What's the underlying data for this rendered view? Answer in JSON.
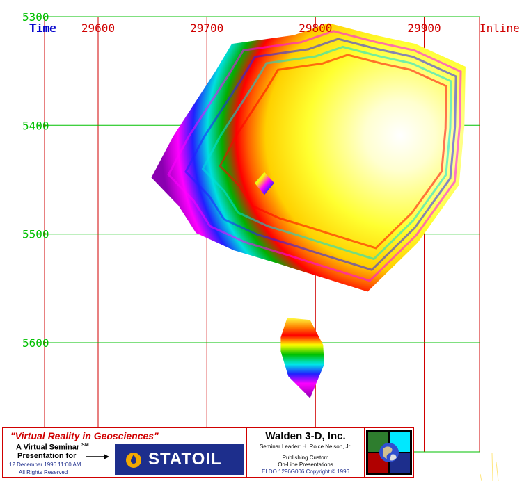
{
  "axes": {
    "corner_labels": [
      "Time",
      "Time",
      "Inline"
    ],
    "x_axis_label": "Inline",
    "top_y_label": "5300"
  },
  "chart_data": {
    "type": "heatmap",
    "title": "",
    "xlabel": "Inline",
    "ylabel": "Time",
    "x_ticks": [
      29600,
      29700,
      29800,
      29900
    ],
    "x_tick_labels": [
      "29600",
      "29700",
      "29800",
      "29900"
    ],
    "y_ticks": [
      5300,
      5400,
      5500,
      5600
    ],
    "y_tick_labels": [
      "5300",
      "5400",
      "5500",
      "5600"
    ],
    "xlim": [
      29525,
      29965
    ],
    "ylim": [
      5300,
      5700
    ],
    "grid": true,
    "colorscale": [
      "#8a00b0",
      "#ff00ff",
      "#3030ff",
      "#00e8e8",
      "#00c000",
      "#ff8000",
      "#ff0000",
      "#ffff00",
      "#ffffe0",
      "#ffffff"
    ],
    "bodies": [
      {
        "name": "main",
        "outline": [
          [
            29723,
            5325
          ],
          [
            29780,
            5317
          ],
          [
            29812,
            5306
          ],
          [
            29855,
            5317
          ],
          [
            29892,
            5325
          ],
          [
            29938,
            5346
          ],
          [
            29937,
            5400
          ],
          [
            29932,
            5455
          ],
          [
            29894,
            5508
          ],
          [
            29848,
            5553
          ],
          [
            29790,
            5535
          ],
          [
            29765,
            5527
          ],
          [
            29725,
            5515
          ],
          [
            29690,
            5499
          ],
          [
            29674,
            5474
          ],
          [
            29649,
            5448
          ],
          [
            29669,
            5410
          ],
          [
            29708,
            5350
          ]
        ],
        "peak": [
          29875,
          5410
        ]
      },
      {
        "name": "small-diamond",
        "outline": [
          [
            29753,
            5443
          ],
          [
            29762,
            5453
          ],
          [
            29753,
            5464
          ],
          [
            29744,
            5453
          ]
        ],
        "peak": [
          29753,
          5453
        ]
      },
      {
        "name": "lower",
        "outline": [
          [
            29774,
            5577
          ],
          [
            29795,
            5579
          ],
          [
            29807,
            5602
          ],
          [
            29808,
            5620
          ],
          [
            29795,
            5651
          ],
          [
            29790,
            5646
          ],
          [
            29775,
            5631
          ],
          [
            29768,
            5608
          ],
          [
            29768,
            5595
          ]
        ],
        "peak": [
          29778,
          5590
        ]
      }
    ]
  },
  "banner": {
    "title": "\"Virtual Reality in Geosciences\"",
    "virtual_seminar": "A Virtual Seminar",
    "sm_mark": "SM",
    "presentation_for": "Presentation for",
    "date_line": "12 December 1996  11:00 AM",
    "rights_line": "All Rights Reserved",
    "sponsor": "STATOIL",
    "company": "Walden 3-D, Inc.",
    "leader": "Seminar Leader: H. Roice Nelson, Jr.",
    "publishing_1": "Publishing Custom",
    "publishing_2": "On-Line Presentations",
    "copyright": "ELDO 1296G006 Copyright © 1996"
  },
  "colors": {
    "grid_red": "#d00000",
    "grid_green": "#00c000",
    "axis_blue": "#0000cc",
    "banner_red": "#d00000",
    "statoil_blue": "#1d2e8c"
  }
}
